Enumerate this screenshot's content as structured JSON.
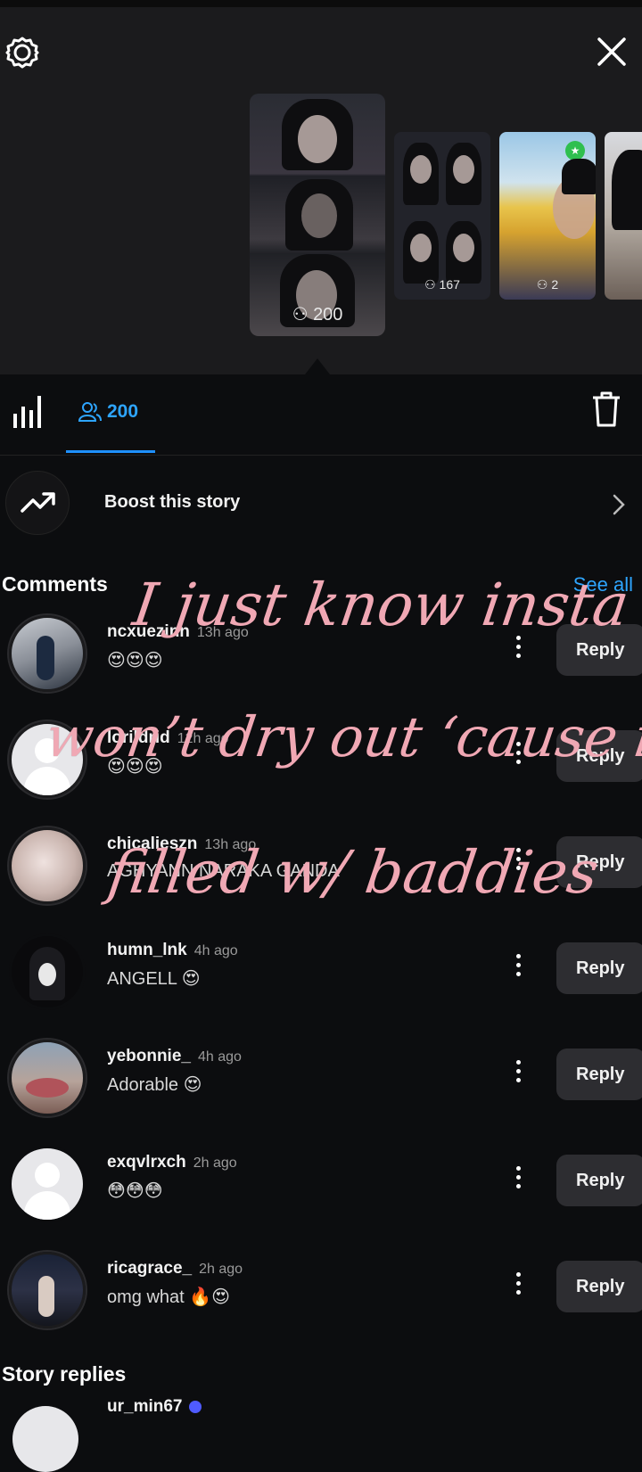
{
  "header": {
    "settings_icon": "gear-icon",
    "close_icon": "close-icon"
  },
  "stories": [
    {
      "viewers": "200",
      "selected": true
    },
    {
      "viewers": "167"
    },
    {
      "viewers": "2"
    },
    {
      "viewers": ""
    }
  ],
  "tabs": {
    "insights_icon": "bar-chart-icon",
    "viewers_count": "200",
    "delete_icon": "trash-icon"
  },
  "boost": {
    "label": "Boost this story"
  },
  "comments": {
    "title": "Comments",
    "see_all": "See all",
    "reply_label": "Reply",
    "items": [
      {
        "username": "ncxuezinn",
        "time": "13h ago",
        "text": "😍😍😍"
      },
      {
        "username": "lorildrid",
        "time": "12h ago",
        "text": "😍😍😍"
      },
      {
        "username": "chicalieszn",
        "time": "13h ago",
        "text": "AGHYANN NARAKA GANDA"
      },
      {
        "username": "humn_lnk",
        "time": "4h ago",
        "text": "ANGELL 😍"
      },
      {
        "username": "yebonnie_",
        "time": "4h ago",
        "text": "Adorable 😍"
      },
      {
        "username": "exqvlrxch",
        "time": "2h ago",
        "text": "😳😳😳"
      },
      {
        "username": "ricagrace_",
        "time": "2h ago",
        "text": "omg what 🔥😍"
      }
    ]
  },
  "story_replies": {
    "title": "Story replies",
    "first_username": "ur_min67"
  },
  "overlay_text": {
    "line1": "I just know insta",
    "line2": "won’t dry out ‘cause it’s",
    "line3": "filled w/ baddies"
  },
  "colors": {
    "accent": "#2ea5ff",
    "overlay_text": "#f0a8b4",
    "background": "#0c0d0f"
  }
}
